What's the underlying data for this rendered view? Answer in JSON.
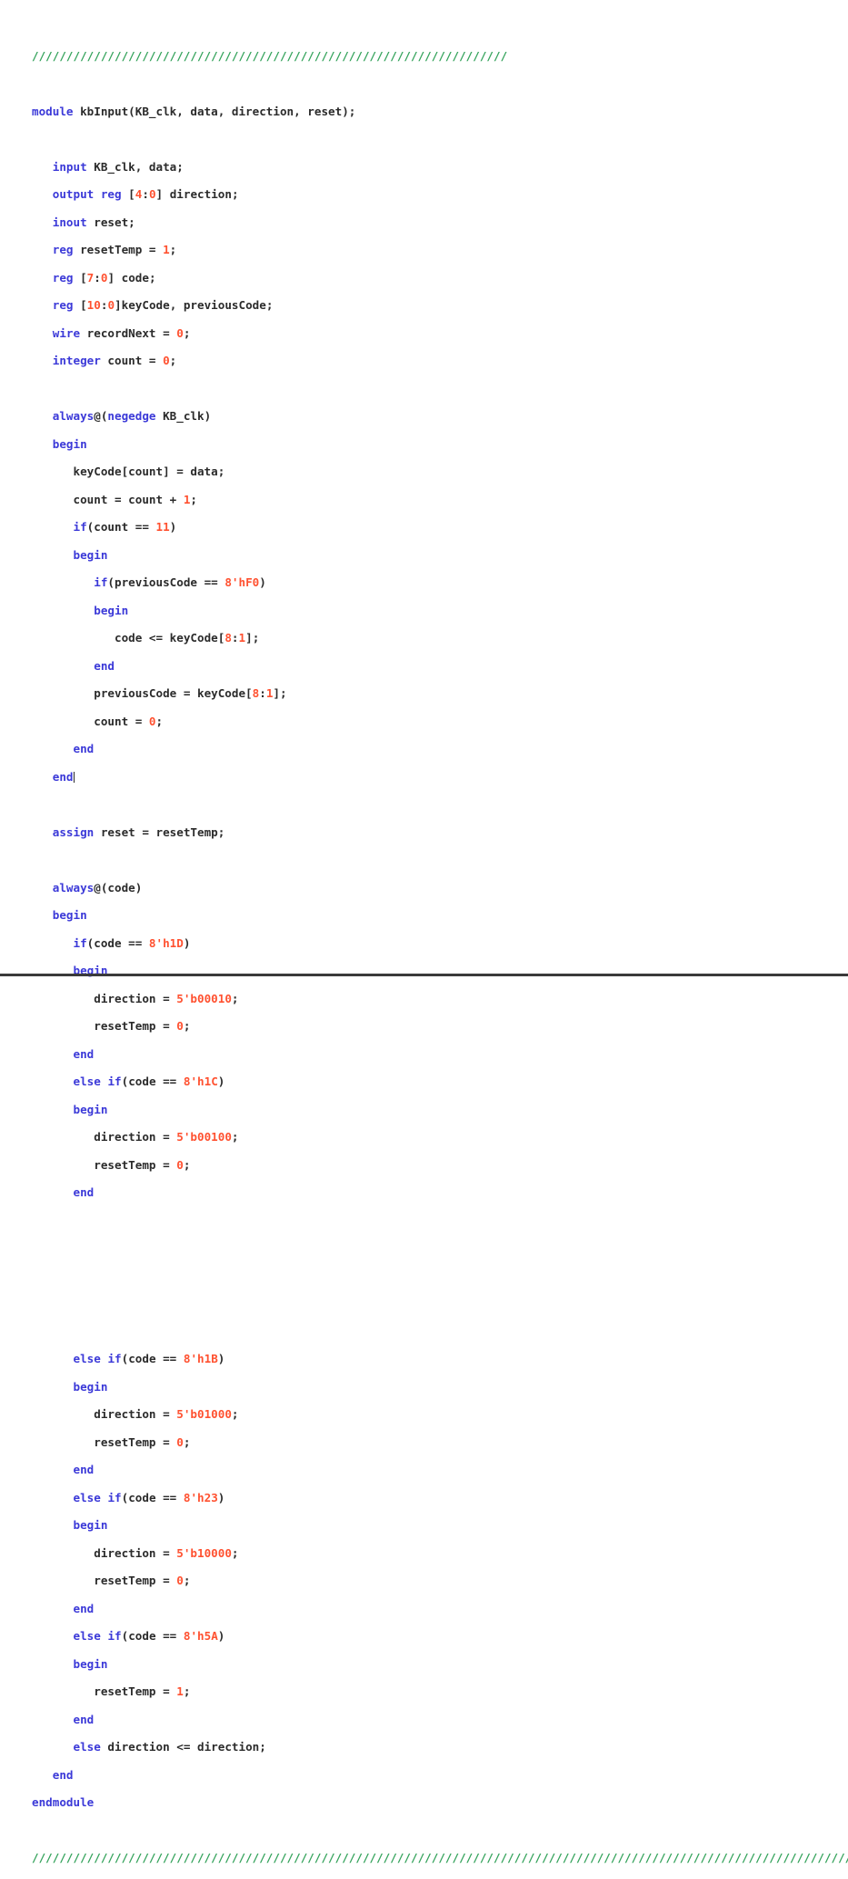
{
  "document": {
    "language": "Verilog",
    "module_name": "kbInput",
    "colors": {
      "background": "#ffffff",
      "keyword": "#3b39d8",
      "number": "#ff5130",
      "comment": "#35a35c",
      "identifier": "#2b2b2b",
      "rule": "#3a3a3a"
    }
  },
  "comment_banner": {
    "top": "/////////////////////////////////////////////////////////////////////",
    "bottom": "////////////////////////////////////////////////////////////////////////////////////////////////////////////////////////"
  },
  "code": {
    "lines": [
      {
        "n": 1,
        "indent": 0,
        "tokens": [
          {
            "t": "/////////////////////////////////////////////////////////////////////",
            "c": "cmt"
          }
        ]
      },
      {
        "n": 2,
        "indent": 0,
        "tokens": []
      },
      {
        "n": 3,
        "indent": 0,
        "tokens": [
          {
            "t": "module",
            "c": "kw"
          },
          {
            "t": " kbInput(KB_clk, data, direction, reset);",
            "c": "id"
          }
        ]
      },
      {
        "n": 4,
        "indent": 0,
        "tokens": []
      },
      {
        "n": 5,
        "indent": 3,
        "tokens": [
          {
            "t": "input",
            "c": "kw"
          },
          {
            "t": " KB_clk, data;",
            "c": "id"
          }
        ]
      },
      {
        "n": 6,
        "indent": 3,
        "tokens": [
          {
            "t": "output",
            "c": "kw"
          },
          {
            "t": " ",
            "c": "id"
          },
          {
            "t": "reg",
            "c": "kw"
          },
          {
            "t": " [",
            "c": "id"
          },
          {
            "t": "4",
            "c": "num"
          },
          {
            "t": ":",
            "c": "id"
          },
          {
            "t": "0",
            "c": "num"
          },
          {
            "t": "] direction;",
            "c": "id"
          }
        ]
      },
      {
        "n": 7,
        "indent": 3,
        "tokens": [
          {
            "t": "inout",
            "c": "kw"
          },
          {
            "t": " reset;",
            "c": "id"
          }
        ]
      },
      {
        "n": 8,
        "indent": 3,
        "tokens": [
          {
            "t": "reg",
            "c": "kw"
          },
          {
            "t": " resetTemp = ",
            "c": "id"
          },
          {
            "t": "1",
            "c": "num"
          },
          {
            "t": ";",
            "c": "id"
          }
        ]
      },
      {
        "n": 9,
        "indent": 3,
        "tokens": [
          {
            "t": "reg",
            "c": "kw"
          },
          {
            "t": " [",
            "c": "id"
          },
          {
            "t": "7",
            "c": "num"
          },
          {
            "t": ":",
            "c": "id"
          },
          {
            "t": "0",
            "c": "num"
          },
          {
            "t": "] code;",
            "c": "id"
          }
        ]
      },
      {
        "n": 10,
        "indent": 3,
        "tokens": [
          {
            "t": "reg",
            "c": "kw"
          },
          {
            "t": " [",
            "c": "id"
          },
          {
            "t": "10",
            "c": "num"
          },
          {
            "t": ":",
            "c": "id"
          },
          {
            "t": "0",
            "c": "num"
          },
          {
            "t": "]keyCode, previousCode;",
            "c": "id"
          }
        ]
      },
      {
        "n": 11,
        "indent": 3,
        "tokens": [
          {
            "t": "wire",
            "c": "kw"
          },
          {
            "t": " recordNext = ",
            "c": "id"
          },
          {
            "t": "0",
            "c": "num"
          },
          {
            "t": ";",
            "c": "id"
          }
        ]
      },
      {
        "n": 12,
        "indent": 3,
        "tokens": [
          {
            "t": "integer",
            "c": "kw"
          },
          {
            "t": " count = ",
            "c": "id"
          },
          {
            "t": "0",
            "c": "num"
          },
          {
            "t": ";",
            "c": "id"
          }
        ]
      },
      {
        "n": 13,
        "indent": 0,
        "tokens": []
      },
      {
        "n": 14,
        "indent": 3,
        "tokens": [
          {
            "t": "always",
            "c": "kw"
          },
          {
            "t": "@(",
            "c": "id"
          },
          {
            "t": "negedge",
            "c": "kw"
          },
          {
            "t": " KB_clk)",
            "c": "id"
          }
        ]
      },
      {
        "n": 15,
        "indent": 3,
        "tokens": [
          {
            "t": "begin",
            "c": "kw"
          }
        ]
      },
      {
        "n": 16,
        "indent": 6,
        "tokens": [
          {
            "t": "keyCode[count] = data;",
            "c": "id"
          }
        ]
      },
      {
        "n": 17,
        "indent": 6,
        "tokens": [
          {
            "t": "count = count + ",
            "c": "id"
          },
          {
            "t": "1",
            "c": "num"
          },
          {
            "t": ";",
            "c": "id"
          }
        ]
      },
      {
        "n": 18,
        "indent": 6,
        "tokens": [
          {
            "t": "if",
            "c": "kw"
          },
          {
            "t": "(count == ",
            "c": "id"
          },
          {
            "t": "11",
            "c": "num"
          },
          {
            "t": ")",
            "c": "id"
          }
        ]
      },
      {
        "n": 19,
        "indent": 6,
        "tokens": [
          {
            "t": "begin",
            "c": "kw"
          }
        ]
      },
      {
        "n": 20,
        "indent": 9,
        "tokens": [
          {
            "t": "if",
            "c": "kw"
          },
          {
            "t": "(previousCode == ",
            "c": "id"
          },
          {
            "t": "8'hF0",
            "c": "num"
          },
          {
            "t": ")",
            "c": "id"
          }
        ]
      },
      {
        "n": 21,
        "indent": 9,
        "tokens": [
          {
            "t": "begin",
            "c": "kw"
          }
        ]
      },
      {
        "n": 22,
        "indent": 12,
        "tokens": [
          {
            "t": "code <= keyCode[",
            "c": "id"
          },
          {
            "t": "8",
            "c": "num"
          },
          {
            "t": ":",
            "c": "id"
          },
          {
            "t": "1",
            "c": "num"
          },
          {
            "t": "];",
            "c": "id"
          }
        ]
      },
      {
        "n": 23,
        "indent": 9,
        "tokens": [
          {
            "t": "end",
            "c": "kw"
          }
        ]
      },
      {
        "n": 24,
        "indent": 9,
        "tokens": [
          {
            "t": "previousCode = keyCode[",
            "c": "id"
          },
          {
            "t": "8",
            "c": "num"
          },
          {
            "t": ":",
            "c": "id"
          },
          {
            "t": "1",
            "c": "num"
          },
          {
            "t": "];",
            "c": "id"
          }
        ]
      },
      {
        "n": 25,
        "indent": 9,
        "tokens": [
          {
            "t": "count = ",
            "c": "id"
          },
          {
            "t": "0",
            "c": "num"
          },
          {
            "t": ";",
            "c": "id"
          }
        ]
      },
      {
        "n": 26,
        "indent": 6,
        "tokens": [
          {
            "t": "end",
            "c": "kw"
          }
        ]
      },
      {
        "n": 27,
        "indent": 3,
        "tokens": [
          {
            "t": "end",
            "c": "kw"
          }
        ],
        "caret": true
      },
      {
        "n": 28,
        "indent": 0,
        "tokens": []
      },
      {
        "n": 29,
        "indent": 3,
        "tokens": [
          {
            "t": "assign",
            "c": "kw"
          },
          {
            "t": " reset = resetTemp;",
            "c": "id"
          }
        ]
      },
      {
        "n": 30,
        "indent": 0,
        "tokens": []
      },
      {
        "n": 31,
        "indent": 3,
        "tokens": [
          {
            "t": "always",
            "c": "kw"
          },
          {
            "t": "@(code)",
            "c": "id"
          }
        ]
      },
      {
        "n": 32,
        "indent": 3,
        "tokens": [
          {
            "t": "begin",
            "c": "kw"
          }
        ]
      },
      {
        "n": 33,
        "indent": 6,
        "tokens": [
          {
            "t": "if",
            "c": "kw"
          },
          {
            "t": "(code == ",
            "c": "id"
          },
          {
            "t": "8'h1D",
            "c": "num"
          },
          {
            "t": ")",
            "c": "id"
          }
        ]
      },
      {
        "n": 34,
        "indent": 6,
        "tokens": [
          {
            "t": "begin",
            "c": "kw"
          }
        ]
      },
      {
        "n": 35,
        "indent": 9,
        "tokens": [
          {
            "t": "direction = ",
            "c": "id"
          },
          {
            "t": "5'b00010",
            "c": "num"
          },
          {
            "t": ";",
            "c": "id"
          }
        ]
      },
      {
        "n": 36,
        "indent": 9,
        "tokens": [
          {
            "t": "resetTemp = ",
            "c": "id"
          },
          {
            "t": "0",
            "c": "num"
          },
          {
            "t": ";",
            "c": "id"
          }
        ]
      },
      {
        "n": 37,
        "indent": 6,
        "tokens": [
          {
            "t": "end",
            "c": "kw"
          }
        ]
      },
      {
        "n": 38,
        "indent": 6,
        "tokens": [
          {
            "t": "else",
            "c": "kw"
          },
          {
            "t": " ",
            "c": "id"
          },
          {
            "t": "if",
            "c": "kw"
          },
          {
            "t": "(code == ",
            "c": "id"
          },
          {
            "t": "8'h1C",
            "c": "num"
          },
          {
            "t": ")",
            "c": "id"
          }
        ]
      },
      {
        "n": 39,
        "indent": 6,
        "tokens": [
          {
            "t": "begin",
            "c": "kw"
          }
        ]
      },
      {
        "n": 40,
        "indent": 9,
        "tokens": [
          {
            "t": "direction = ",
            "c": "id"
          },
          {
            "t": "5'b00100",
            "c": "num"
          },
          {
            "t": ";",
            "c": "id"
          }
        ]
      },
      {
        "n": 41,
        "indent": 9,
        "tokens": [
          {
            "t": "resetTemp = ",
            "c": "id"
          },
          {
            "t": "0",
            "c": "num"
          },
          {
            "t": ";",
            "c": "id"
          }
        ]
      },
      {
        "n": 42,
        "indent": 6,
        "tokens": [
          {
            "t": "end",
            "c": "kw"
          }
        ]
      },
      {
        "n": 43,
        "indent": 0,
        "tokens": []
      },
      {
        "n": 44,
        "indent": 0,
        "tokens": []
      },
      {
        "n": 45,
        "indent": 0,
        "tokens": []
      },
      {
        "n": 46,
        "indent": 0,
        "tokens": []
      },
      {
        "n": 47,
        "indent": 0,
        "tokens": []
      },
      {
        "n": 48,
        "indent": 6,
        "tokens": [
          {
            "t": "else",
            "c": "kw"
          },
          {
            "t": " ",
            "c": "id"
          },
          {
            "t": "if",
            "c": "kw"
          },
          {
            "t": "(code == ",
            "c": "id"
          },
          {
            "t": "8'h1B",
            "c": "num"
          },
          {
            "t": ")",
            "c": "id"
          }
        ]
      },
      {
        "n": 49,
        "indent": 6,
        "tokens": [
          {
            "t": "begin",
            "c": "kw"
          }
        ]
      },
      {
        "n": 50,
        "indent": 9,
        "tokens": [
          {
            "t": "direction = ",
            "c": "id"
          },
          {
            "t": "5'b01000",
            "c": "num"
          },
          {
            "t": ";",
            "c": "id"
          }
        ]
      },
      {
        "n": 51,
        "indent": 9,
        "tokens": [
          {
            "t": "resetTemp = ",
            "c": "id"
          },
          {
            "t": "0",
            "c": "num"
          },
          {
            "t": ";",
            "c": "id"
          }
        ]
      },
      {
        "n": 52,
        "indent": 6,
        "tokens": [
          {
            "t": "end",
            "c": "kw"
          }
        ]
      },
      {
        "n": 53,
        "indent": 6,
        "tokens": [
          {
            "t": "else",
            "c": "kw"
          },
          {
            "t": " ",
            "c": "id"
          },
          {
            "t": "if",
            "c": "kw"
          },
          {
            "t": "(code == ",
            "c": "id"
          },
          {
            "t": "8'h23",
            "c": "num"
          },
          {
            "t": ")",
            "c": "id"
          }
        ]
      },
      {
        "n": 54,
        "indent": 6,
        "tokens": [
          {
            "t": "begin",
            "c": "kw"
          }
        ]
      },
      {
        "n": 55,
        "indent": 9,
        "tokens": [
          {
            "t": "direction = ",
            "c": "id"
          },
          {
            "t": "5'b10000",
            "c": "num"
          },
          {
            "t": ";",
            "c": "id"
          }
        ]
      },
      {
        "n": 56,
        "indent": 9,
        "tokens": [
          {
            "t": "resetTemp = ",
            "c": "id"
          },
          {
            "t": "0",
            "c": "num"
          },
          {
            "t": ";",
            "c": "id"
          }
        ]
      },
      {
        "n": 57,
        "indent": 6,
        "tokens": [
          {
            "t": "end",
            "c": "kw"
          }
        ]
      },
      {
        "n": 58,
        "indent": 6,
        "tokens": [
          {
            "t": "else",
            "c": "kw"
          },
          {
            "t": " ",
            "c": "id"
          },
          {
            "t": "if",
            "c": "kw"
          },
          {
            "t": "(code == ",
            "c": "id"
          },
          {
            "t": "8'h5A",
            "c": "num"
          },
          {
            "t": ")",
            "c": "id"
          }
        ]
      },
      {
        "n": 59,
        "indent": 6,
        "tokens": [
          {
            "t": "begin",
            "c": "kw"
          }
        ]
      },
      {
        "n": 60,
        "indent": 9,
        "tokens": [
          {
            "t": "resetTemp = ",
            "c": "id"
          },
          {
            "t": "1",
            "c": "num"
          },
          {
            "t": ";",
            "c": "id"
          }
        ]
      },
      {
        "n": 61,
        "indent": 6,
        "tokens": [
          {
            "t": "end",
            "c": "kw"
          }
        ]
      },
      {
        "n": 62,
        "indent": 6,
        "tokens": [
          {
            "t": "else",
            "c": "kw"
          },
          {
            "t": " direction <= direction;",
            "c": "id"
          }
        ]
      },
      {
        "n": 63,
        "indent": 3,
        "tokens": [
          {
            "t": "end",
            "c": "kw"
          }
        ]
      },
      {
        "n": 64,
        "indent": 0,
        "tokens": [
          {
            "t": "endmodule",
            "c": "kw"
          }
        ]
      },
      {
        "n": 65,
        "indent": 0,
        "tokens": []
      },
      {
        "n": 66,
        "indent": 0,
        "tokens": [
          {
            "t": "////////////////////////////////////////////////////////////////////////////////////////////////////////////////////////",
            "c": "cmt"
          }
        ]
      }
    ]
  }
}
